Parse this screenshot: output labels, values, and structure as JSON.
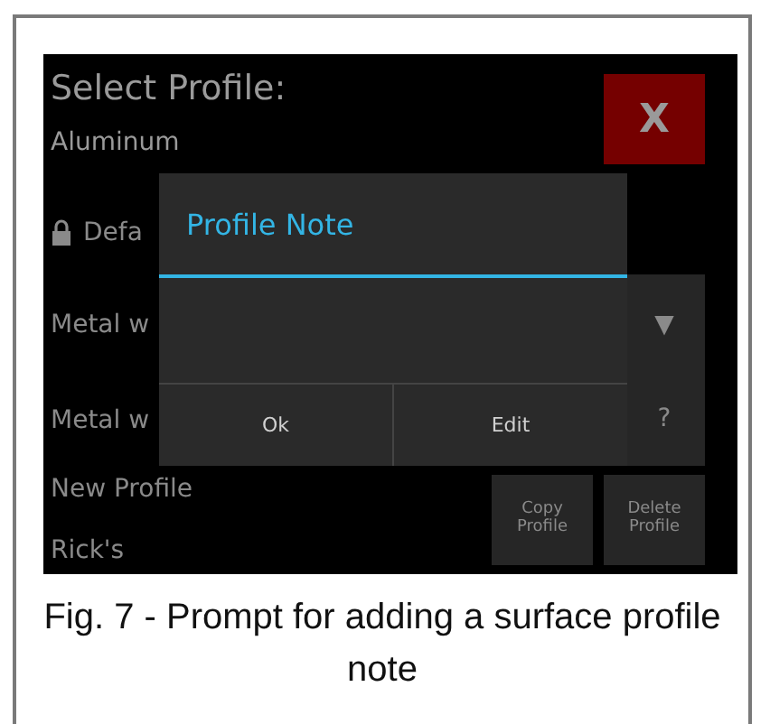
{
  "screen": {
    "title": "Select Profile:",
    "current_profile": "Aluminum",
    "close_button": "X",
    "profiles": [
      {
        "label": "Defa",
        "locked": true
      },
      {
        "label": "Metal w",
        "locked": false
      },
      {
        "label": "Metal w",
        "locked": false
      },
      {
        "label": "New Profile",
        "locked": false
      },
      {
        "label": "Rick's",
        "locked": false
      }
    ],
    "dropdown_button": "▼",
    "help_button": "?",
    "copy_button": "Copy Profile",
    "delete_button": "Delete Profile"
  },
  "dialog": {
    "title": "Profile Note",
    "buttons": [
      "Ok",
      "Edit"
    ]
  },
  "caption": "Fig. 7 - Prompt for adding a surface profile note"
}
